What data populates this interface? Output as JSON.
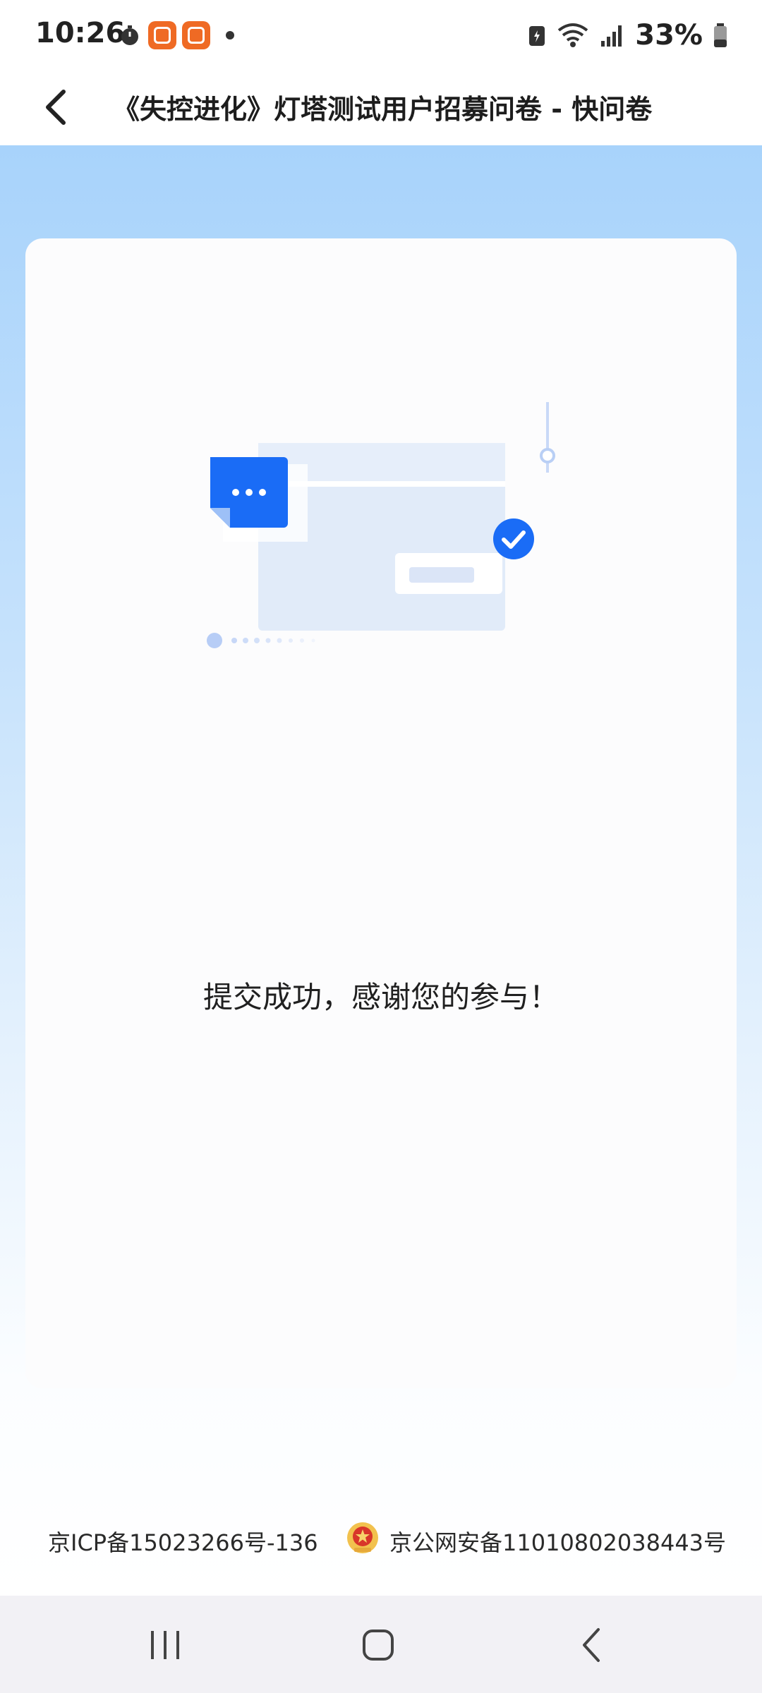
{
  "status_bar": {
    "time": "10:26",
    "battery_percent": "33%",
    "icons": [
      "timer-icon",
      "app-notification-icon",
      "app-notification-icon",
      "dot-icon",
      "battery-saver-icon",
      "wifi-icon",
      "signal-icon",
      "battery-icon"
    ]
  },
  "titlebar": {
    "title": "《失控进化》灯塔测试用户招募问卷 - 快问卷",
    "back_icon": "chevron-left-icon"
  },
  "content": {
    "illustration_icon": "submit-success-illustration",
    "success_message": "提交成功，感谢您的参与！"
  },
  "footer": {
    "icp": "京ICP备15023266号-136",
    "police_record": "京公网安备11010802038443号",
    "police_icon": "police-emblem-icon"
  },
  "system_nav": {
    "buttons": [
      "recents-icon",
      "home-icon",
      "back-icon"
    ]
  },
  "colors": {
    "accent": "#1a6cf6",
    "bg_top": "#a8d3fb",
    "card": "#fcfcfd"
  }
}
